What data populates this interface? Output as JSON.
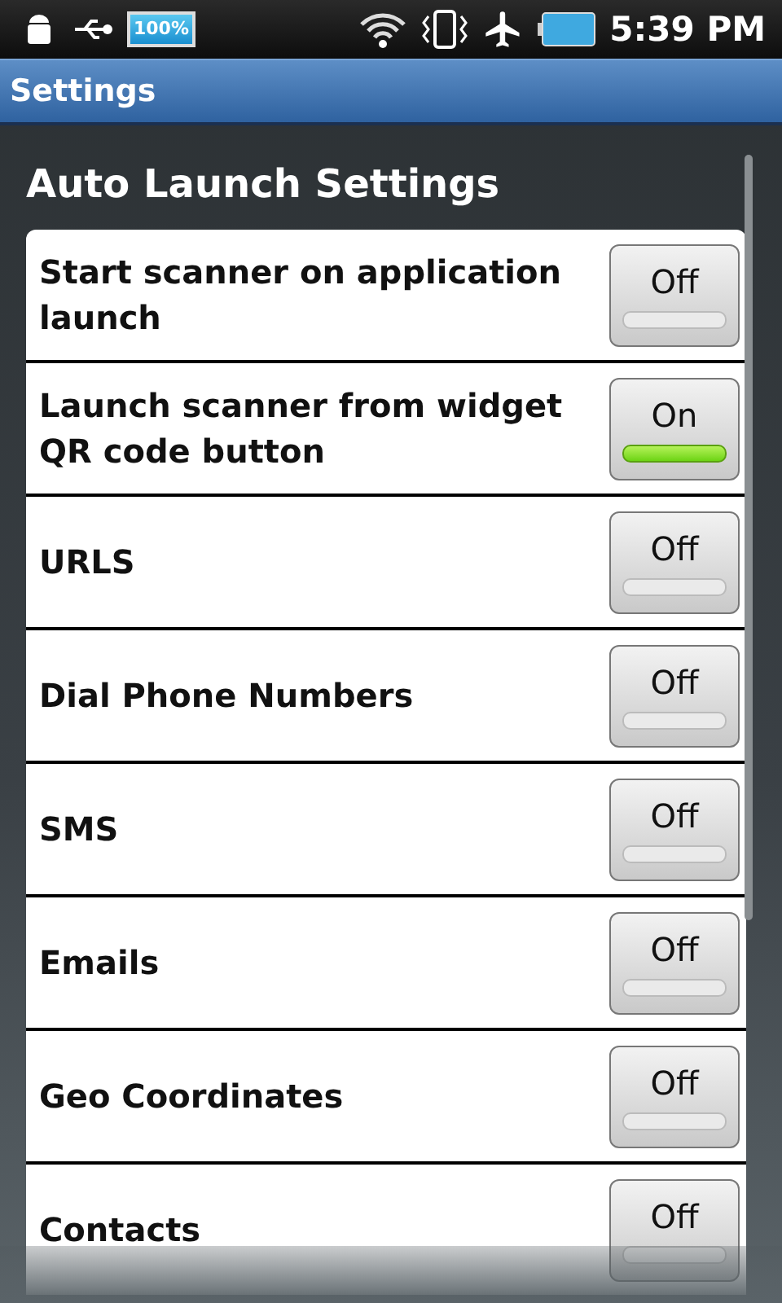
{
  "status_bar": {
    "battery_text": "100%",
    "time": "5:39 PM"
  },
  "title_bar": {
    "title": "Settings"
  },
  "section": {
    "title": "Auto Launch Settings"
  },
  "settings": [
    {
      "label": "Start scanner on application launch",
      "toggle_text": "Off",
      "on": false
    },
    {
      "label": "Launch scanner from widget QR code button",
      "toggle_text": "On",
      "on": true
    },
    {
      "label": "URLS",
      "toggle_text": "Off",
      "on": false
    },
    {
      "label": "Dial Phone Numbers",
      "toggle_text": "Off",
      "on": false
    },
    {
      "label": "SMS",
      "toggle_text": "Off",
      "on": false
    },
    {
      "label": "Emails",
      "toggle_text": "Off",
      "on": false
    },
    {
      "label": "Geo Coordinates",
      "toggle_text": "Off",
      "on": false
    },
    {
      "label": "Contacts",
      "toggle_text": "Off",
      "on": false
    }
  ]
}
